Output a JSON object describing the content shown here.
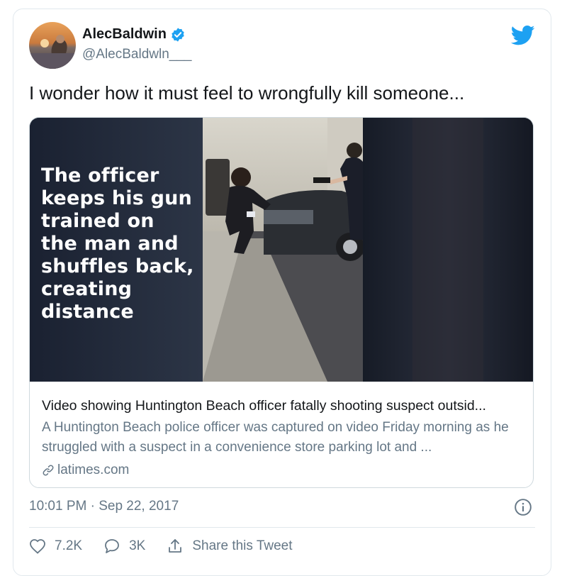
{
  "user": {
    "display_name": "AlecBaldwin",
    "handle": "@AlecBaldwln___",
    "avatar_icon": "avatar-photo",
    "verified_icon": "verified-badge-icon"
  },
  "tweet": {
    "text": "I wonder how it must feel to wrongfully kill someone..."
  },
  "link_card": {
    "overlay_caption": [
      "The officer",
      "keeps his gun",
      "trained on",
      "the man and",
      "shuffles back,",
      "creating",
      "distance"
    ],
    "title": "Video showing Huntington Beach officer fatally shooting suspect outsid...",
    "description": "A Huntington Beach police officer was captured on video Friday morning as he struggled with a suspect in a convenience store parking lot and ...",
    "domain": "latimes.com"
  },
  "meta": {
    "timestamp": "10:01 PM · Sep 22, 2017"
  },
  "actions": {
    "likes": "7.2K",
    "replies": "3K",
    "share_label": "Share this Tweet"
  },
  "colors": {
    "twitter_blue": "#1da1f2",
    "secondary_text": "#657786",
    "primary_text": "#14171a",
    "border": "#e1e8ed"
  }
}
